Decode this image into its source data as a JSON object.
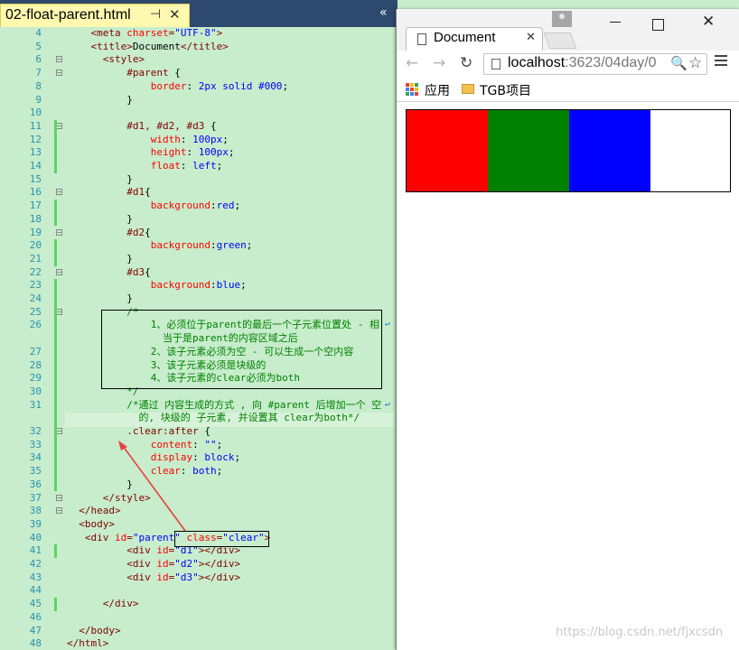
{
  "editor": {
    "tab_label": "02-float-parent.html",
    "pin_glyph": "⊣",
    "close_glyph": "✕",
    "overflow_glyph": "«",
    "lines": [
      {
        "n": "4",
        "parts": [
          [
            "    ",
            ""
          ],
          [
            "<meta ",
            "t"
          ],
          [
            "charset",
            "a"
          ],
          [
            "=",
            "t"
          ],
          [
            "\"UTF-8\"",
            "s"
          ],
          [
            ">",
            "t"
          ]
        ]
      },
      {
        "n": "5",
        "parts": [
          [
            "    ",
            ""
          ],
          [
            "<title>",
            "t"
          ],
          [
            "Document",
            ""
          ],
          [
            "</title>",
            "t"
          ]
        ]
      },
      {
        "n": "6",
        "parts": [
          [
            "      ",
            ""
          ],
          [
            "<style>",
            "t"
          ]
        ]
      },
      {
        "n": "7",
        "parts": [
          [
            "          ",
            ""
          ],
          [
            "#parent",
            "sel"
          ],
          [
            " {",
            ""
          ]
        ]
      },
      {
        "n": "8",
        "parts": [
          [
            "              ",
            ""
          ],
          [
            "border",
            "p"
          ],
          [
            ": ",
            ""
          ],
          [
            "2px solid #000",
            "v"
          ],
          [
            ";",
            ""
          ]
        ]
      },
      {
        "n": "9",
        "parts": [
          [
            "          }",
            ""
          ]
        ]
      },
      {
        "n": "10",
        "parts": [
          [
            "",
            ""
          ]
        ]
      },
      {
        "n": "11",
        "parts": [
          [
            "          ",
            ""
          ],
          [
            "#d1, #d2, #d3",
            "sel"
          ],
          [
            " {",
            ""
          ]
        ]
      },
      {
        "n": "12",
        "parts": [
          [
            "              ",
            ""
          ],
          [
            "width",
            "p"
          ],
          [
            ": ",
            ""
          ],
          [
            "100px",
            "v"
          ],
          [
            ";",
            ""
          ]
        ]
      },
      {
        "n": "13",
        "parts": [
          [
            "              ",
            ""
          ],
          [
            "height",
            "p"
          ],
          [
            ": ",
            ""
          ],
          [
            "100px",
            "v"
          ],
          [
            ";",
            ""
          ]
        ]
      },
      {
        "n": "14",
        "parts": [
          [
            "              ",
            ""
          ],
          [
            "float",
            "p"
          ],
          [
            ": ",
            ""
          ],
          [
            "left",
            "v"
          ],
          [
            ";",
            ""
          ]
        ]
      },
      {
        "n": "15",
        "parts": [
          [
            "          }",
            ""
          ]
        ]
      },
      {
        "n": "16",
        "parts": [
          [
            "          ",
            ""
          ],
          [
            "#d1",
            "sel"
          ],
          [
            "{",
            ""
          ]
        ]
      },
      {
        "n": "17",
        "parts": [
          [
            "              ",
            ""
          ],
          [
            "background",
            "p"
          ],
          [
            ":",
            ""
          ],
          [
            "red",
            "v"
          ],
          [
            ";",
            ""
          ]
        ]
      },
      {
        "n": "18",
        "parts": [
          [
            "          }",
            ""
          ]
        ]
      },
      {
        "n": "19",
        "parts": [
          [
            "          ",
            ""
          ],
          [
            "#d2",
            "sel"
          ],
          [
            "{",
            ""
          ]
        ]
      },
      {
        "n": "20",
        "parts": [
          [
            "              ",
            ""
          ],
          [
            "background",
            "p"
          ],
          [
            ":",
            ""
          ],
          [
            "green",
            "v"
          ],
          [
            ";",
            ""
          ]
        ]
      },
      {
        "n": "21",
        "parts": [
          [
            "          }",
            ""
          ]
        ]
      },
      {
        "n": "22",
        "parts": [
          [
            "          ",
            ""
          ],
          [
            "#d3",
            "sel"
          ],
          [
            "{",
            ""
          ]
        ]
      },
      {
        "n": "23",
        "parts": [
          [
            "              ",
            ""
          ],
          [
            "background",
            "p"
          ],
          [
            ":",
            ""
          ],
          [
            "blue",
            "v"
          ],
          [
            ";",
            ""
          ]
        ]
      },
      {
        "n": "24",
        "parts": [
          [
            "          }",
            ""
          ]
        ]
      },
      {
        "n": "25",
        "parts": [
          [
            "          ",
            ""
          ],
          [
            "/*",
            "c"
          ]
        ]
      },
      {
        "n": "26",
        "parts": [
          [
            "              ",
            ""
          ],
          [
            "1、必须位于parent的最后一个子元素位置处 - 相",
            "c"
          ]
        ]
      },
      {
        "n": "",
        "parts": [
          [
            "                ",
            ""
          ],
          [
            "当于是parent的内容区域之后",
            "c"
          ]
        ]
      },
      {
        "n": "27",
        "parts": [
          [
            "              ",
            ""
          ],
          [
            "2、该子元素必须为空 - 可以生成一个空内容",
            "c"
          ]
        ]
      },
      {
        "n": "28",
        "parts": [
          [
            "              ",
            ""
          ],
          [
            "3、该子元素必须是块级的",
            "c"
          ]
        ]
      },
      {
        "n": "29",
        "parts": [
          [
            "              ",
            ""
          ],
          [
            "4、该子元素的clear必须为both",
            "c"
          ]
        ]
      },
      {
        "n": "30",
        "parts": [
          [
            "          ",
            ""
          ],
          [
            "*/",
            "c"
          ]
        ]
      },
      {
        "n": "31",
        "parts": [
          [
            "          ",
            ""
          ],
          [
            "/*通过 内容生成的方式 , 向 #parent 后增加一个 空",
            "c"
          ]
        ]
      },
      {
        "n": "",
        "parts": [
          [
            "            ",
            ""
          ],
          [
            "的, 块级的 子元素, 并设置其 clear为both*/",
            "c"
          ]
        ]
      },
      {
        "n": "32",
        "parts": [
          [
            "          ",
            ""
          ],
          [
            ".clear:after",
            "sel"
          ],
          [
            " {",
            ""
          ]
        ]
      },
      {
        "n": "33",
        "parts": [
          [
            "              ",
            ""
          ],
          [
            "content",
            "p"
          ],
          [
            ": ",
            ""
          ],
          [
            "\"\"",
            "v"
          ],
          [
            ";",
            ""
          ]
        ]
      },
      {
        "n": "34",
        "parts": [
          [
            "              ",
            ""
          ],
          [
            "display",
            "p"
          ],
          [
            ": ",
            ""
          ],
          [
            "block",
            "v"
          ],
          [
            ";",
            ""
          ]
        ]
      },
      {
        "n": "35",
        "parts": [
          [
            "              ",
            ""
          ],
          [
            "clear",
            "p"
          ],
          [
            ": ",
            ""
          ],
          [
            "both",
            "v"
          ],
          [
            ";",
            ""
          ]
        ]
      },
      {
        "n": "36",
        "parts": [
          [
            "          }",
            ""
          ]
        ]
      },
      {
        "n": "37",
        "parts": [
          [
            "      ",
            ""
          ],
          [
            "</style>",
            "t"
          ]
        ]
      },
      {
        "n": "38",
        "parts": [
          [
            "  ",
            ""
          ],
          [
            "</head>",
            "t"
          ]
        ]
      },
      {
        "n": "39",
        "parts": [
          [
            "  ",
            ""
          ],
          [
            "<body>",
            "t"
          ]
        ]
      },
      {
        "n": "40",
        "parts": [
          [
            "   ",
            ""
          ],
          [
            "<div ",
            "t"
          ],
          [
            "id",
            "a"
          ],
          [
            "=",
            "t"
          ],
          [
            "\"parent\"",
            "s"
          ],
          [
            " ",
            ""
          ],
          [
            "class",
            "a"
          ],
          [
            "=",
            "t"
          ],
          [
            "\"clear\"",
            "s"
          ],
          [
            ">",
            "t"
          ]
        ]
      },
      {
        "n": "41",
        "parts": [
          [
            "          ",
            ""
          ],
          [
            "<div ",
            "t"
          ],
          [
            "id",
            "a"
          ],
          [
            "=",
            "t"
          ],
          [
            "\"d1\"",
            "s"
          ],
          [
            "></div>",
            "t"
          ]
        ]
      },
      {
        "n": "42",
        "parts": [
          [
            "          ",
            ""
          ],
          [
            "<div ",
            "t"
          ],
          [
            "id",
            "a"
          ],
          [
            "=",
            "t"
          ],
          [
            "\"d2\"",
            "s"
          ],
          [
            "></div>",
            "t"
          ]
        ]
      },
      {
        "n": "43",
        "parts": [
          [
            "          ",
            ""
          ],
          [
            "<div ",
            "t"
          ],
          [
            "id",
            "a"
          ],
          [
            "=",
            "t"
          ],
          [
            "\"d3\"",
            "s"
          ],
          [
            "></div>",
            "t"
          ]
        ]
      },
      {
        "n": "44",
        "parts": [
          [
            "",
            ""
          ]
        ]
      },
      {
        "n": "45",
        "parts": [
          [
            "      ",
            ""
          ],
          [
            "</div>",
            "t"
          ]
        ]
      },
      {
        "n": "46",
        "parts": [
          [
            "",
            ""
          ]
        ]
      },
      {
        "n": "47",
        "parts": [
          [
            "  ",
            ""
          ],
          [
            "</body>",
            "t"
          ]
        ]
      },
      {
        "n": "48",
        "parts": [
          [
            "",
            ""
          ],
          [
            "</html>",
            "t"
          ]
        ]
      }
    ]
  },
  "browser": {
    "tab_label": "Document",
    "tab_close_glyph": "✕",
    "back_glyph": "←",
    "forward_glyph": "→",
    "reload_glyph": "↻",
    "url_host": "localhost",
    "url_rest": ":3623/04day/0",
    "zoom_glyph": "🔍",
    "star_glyph": "☆",
    "close_glyph": "✕",
    "bookmarks": {
      "apps": "应用",
      "folder": "TGB项目"
    },
    "boxes": [
      {
        "name": "d1",
        "color": "#ff0000"
      },
      {
        "name": "d2",
        "color": "#008000"
      },
      {
        "name": "d3",
        "color": "#0000ff"
      }
    ]
  },
  "watermark": "https://blog.csdn.net/fjxcsdn"
}
